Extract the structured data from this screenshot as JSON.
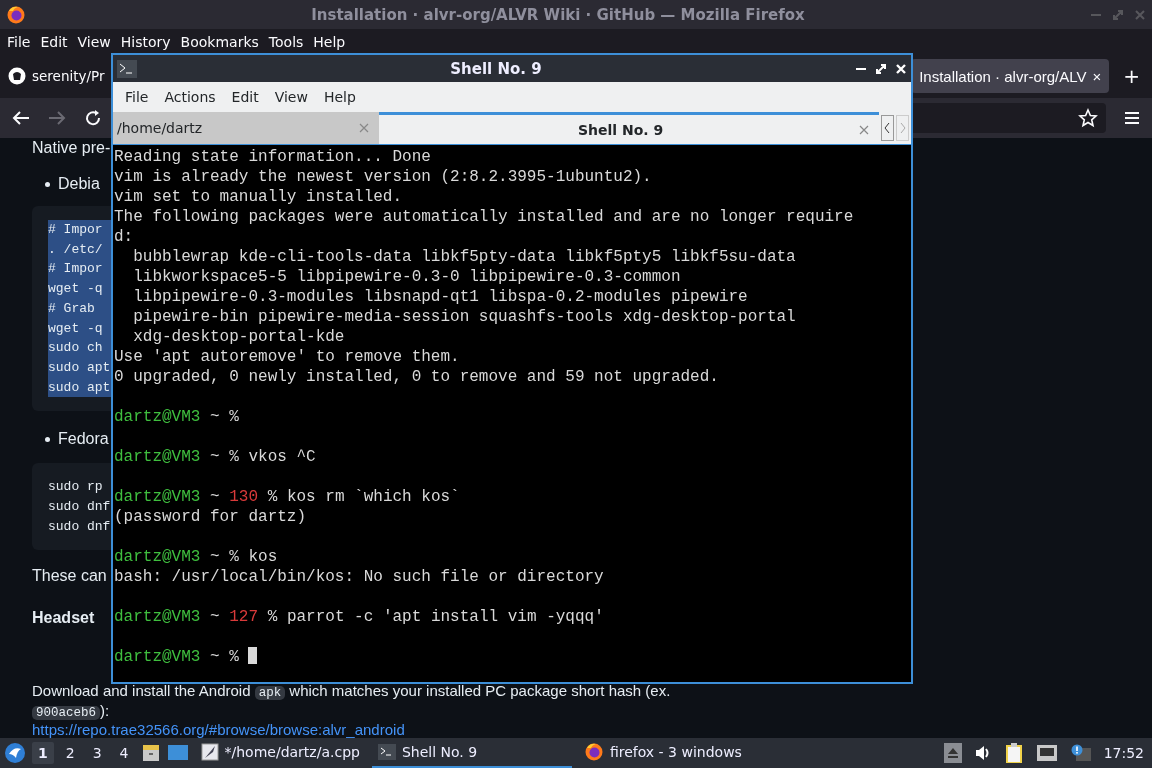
{
  "browser": {
    "title": "Installation · alvr-org/ALVR Wiki · GitHub — Mozilla Firefox",
    "menu": [
      "File",
      "Edit",
      "View",
      "History",
      "Bookmarks",
      "Tools",
      "Help"
    ],
    "tabs": [
      {
        "label": "serenity/Pr",
        "selected": false
      },
      {
        "label": "Installation · alvr-org/ALV",
        "selected": true,
        "close": "×"
      }
    ],
    "new_tab": "+",
    "page": {
      "intro": "Native pre-",
      "sections": [
        {
          "bullet": "Debia",
          "highlighted": true,
          "code": [
            "# Impor",
            ". /etc/",
            "# Impor",
            "wget -q",
            "# Grab",
            "wget -q",
            "sudo ch",
            "sudo apt",
            "sudo apt"
          ]
        },
        {
          "bullet": "Fedora",
          "highlighted": false,
          "code": [
            "sudo rp",
            "sudo dnf",
            "sudo dnf"
          ]
        }
      ],
      "note": "These can",
      "heading": "Headset",
      "download": {
        "before": "Download and install the Android",
        "code": "apk",
        "after": "which matches your installed PC package short hash (ex.",
        "hash": "900aceb6",
        "tail": "):"
      },
      "link": "https://repo.trae32566.org/#browse/browse:alvr_android"
    }
  },
  "terminal": {
    "title": "Shell No. 9",
    "menu": [
      "File",
      "Actions",
      "Edit",
      "View",
      "Help"
    ],
    "tabs": [
      {
        "label": "/home/dartz",
        "selected": false
      },
      {
        "label": "Shell No. 9",
        "selected": true
      }
    ],
    "lines": [
      {
        "kind": "output",
        "text": "Reading state information... Done"
      },
      {
        "kind": "output",
        "text": "vim is already the newest version (2:8.2.3995-1ubuntu2)."
      },
      {
        "kind": "output",
        "text": "vim set to manually installed."
      },
      {
        "kind": "output",
        "text": "The following packages were automatically installed and are no longer require"
      },
      {
        "kind": "output",
        "text": "d:"
      },
      {
        "kind": "output",
        "text": "  bubblewrap kde-cli-tools-data libkf5pty-data libkf5pty5 libkf5su-data"
      },
      {
        "kind": "output",
        "text": "  libkworkspace5-5 libpipewire-0.3-0 libpipewire-0.3-common"
      },
      {
        "kind": "output",
        "text": "  libpipewire-0.3-modules libsnapd-qt1 libspa-0.2-modules pipewire"
      },
      {
        "kind": "output",
        "text": "  pipewire-bin pipewire-media-session squashfs-tools xdg-desktop-portal"
      },
      {
        "kind": "output",
        "text": "  xdg-desktop-portal-kde"
      },
      {
        "kind": "output",
        "text": "Use 'apt autoremove' to remove them."
      },
      {
        "kind": "output",
        "text": "0 upgraded, 0 newly installed, 0 to remove and 59 not upgraded."
      },
      {
        "kind": "blank"
      },
      {
        "kind": "prompt",
        "user": "dartz@VM3",
        "path": "~",
        "symbol": "%",
        "cursor": false
      },
      {
        "kind": "blank"
      },
      {
        "kind": "prompt",
        "user": "dartz@VM3",
        "path": "~",
        "symbol": "%",
        "command": "vkos ^C",
        "cursor": false
      },
      {
        "kind": "blank"
      },
      {
        "kind": "prompt",
        "user": "dartz@VM3",
        "path": "~",
        "status": "130",
        "symbol": "%",
        "command": "kos rm `which kos`",
        "cursor": false
      },
      {
        "kind": "output",
        "text": "(password for dartz)"
      },
      {
        "kind": "blank"
      },
      {
        "kind": "prompt",
        "user": "dartz@VM3",
        "path": "~",
        "symbol": "%",
        "command": "kos",
        "cursor": false
      },
      {
        "kind": "output",
        "text": "bash: /usr/local/bin/kos: No such file or directory"
      },
      {
        "kind": "blank"
      },
      {
        "kind": "prompt",
        "user": "dartz@VM3",
        "path": "~",
        "status": "127",
        "symbol": "%",
        "command": "parrot -c 'apt install vim -yqqq'",
        "cursor": false
      },
      {
        "kind": "blank"
      },
      {
        "kind": "prompt",
        "user": "dartz@VM3",
        "path": "~",
        "symbol": "%",
        "cursor": true
      }
    ]
  },
  "taskbar": {
    "workspaces": [
      {
        "label": "1",
        "selected": true
      },
      {
        "label": "2",
        "selected": false
      },
      {
        "label": "3",
        "selected": false
      },
      {
        "label": "4",
        "selected": false
      }
    ],
    "tasks": [
      {
        "kind": "editor",
        "label": "*/home/dartz/a.cpp",
        "selected": false
      },
      {
        "kind": "terminal",
        "label": "Shell No. 9",
        "selected": true
      },
      {
        "kind": "firefox",
        "label": "firefox - 3 windows",
        "selected": false
      }
    ],
    "clock": "17:52"
  }
}
